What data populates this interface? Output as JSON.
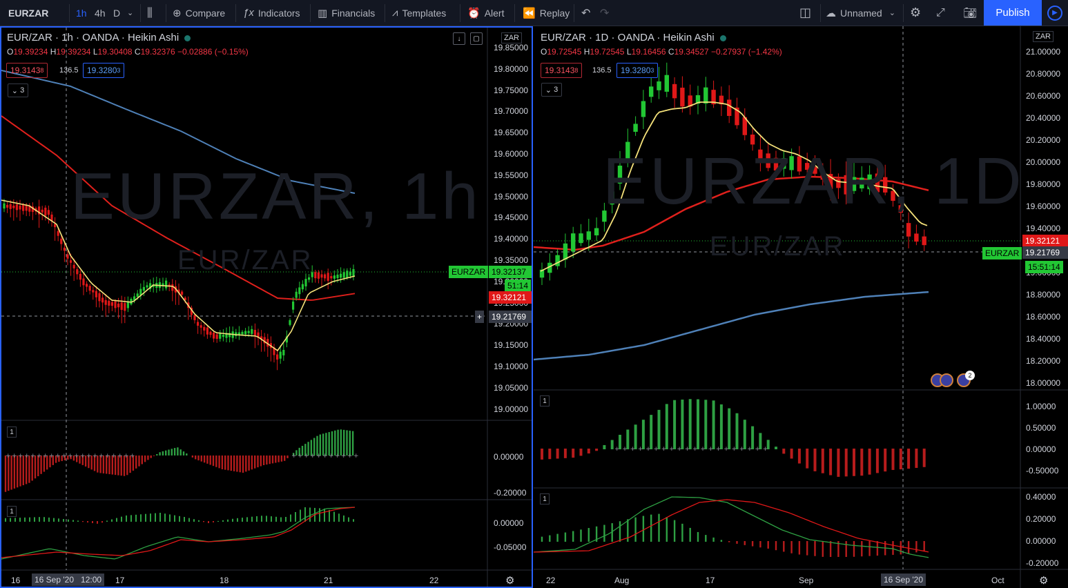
{
  "toolbar": {
    "symbol": "EURZAR",
    "intervals": [
      "1h",
      "4h",
      "D"
    ],
    "compare": "Compare",
    "indicators": "Indicators",
    "financials": "Financials",
    "templates": "Templates",
    "alert": "Alert",
    "replay": "Replay",
    "layout_name": "Unnamed",
    "publish": "Publish"
  },
  "left_chart": {
    "title": "EUR/ZAR · 1h · OANDA · Heikin Ashi",
    "ohlc": {
      "o": "19.39234",
      "h": "19.39234",
      "l": "19.30408",
      "c": "19.32376",
      "chg": "−0.02886 (−0.15%)"
    },
    "ma1": "19.3143",
    "ma1_sub": "8",
    "ma_mid": "136.5",
    "ma2": "19.3280",
    "ma2_sub": "3",
    "collapse": "3",
    "watermark": "EURZAR, 1h",
    "watermark_sub": "EUR/ZAR",
    "currency": "ZAR",
    "price_axis": [
      "19.85000",
      "19.80000",
      "19.75000",
      "19.70000",
      "19.65000",
      "19.60000",
      "19.55000",
      "19.50000",
      "19.45000",
      "19.40000",
      "19.35000",
      "19.30000",
      "19.25000",
      "19.20000",
      "19.15000",
      "19.10000",
      "19.05000",
      "19.00000"
    ],
    "tag_symbol": "EURZAR",
    "tag_price": "19.32137",
    "tag_timer": "51:14",
    "tag_red": "19.32121",
    "tag_cross": "19.21769",
    "osc1_num": "1",
    "osc1_axis": [
      "0.00000",
      "-0.20000"
    ],
    "osc2_num": "1",
    "osc2_axis": [
      "0.00000",
      "-0.05000"
    ],
    "time_axis": [
      "16",
      "17",
      "18",
      "21",
      "22"
    ],
    "time_highlight": "16 Sep '20",
    "time_highlight2": "12:00"
  },
  "right_chart": {
    "title": "EUR/ZAR · 1D · OANDA · Heikin Ashi",
    "ohlc": {
      "o": "19.72545",
      "h": "19.72545",
      "l": "19.16456",
      "c": "19.34527",
      "chg": "−0.27937 (−1.42%)"
    },
    "ma1": "19.3143",
    "ma1_sub": "8",
    "ma_mid": "136.5",
    "ma2": "19.3280",
    "ma2_sub": "3",
    "collapse": "3",
    "watermark": "EURZAR, 1D",
    "watermark_sub": "EUR/ZAR",
    "currency": "ZAR",
    "price_axis": [
      "21.00000",
      "20.80000",
      "20.60000",
      "20.40000",
      "20.20000",
      "20.00000",
      "19.80000",
      "19.60000",
      "19.40000",
      "19.00000",
      "18.80000",
      "18.60000",
      "18.40000",
      "18.20000",
      "18.00000"
    ],
    "tag_red": "19.32121",
    "tag_cross": "19.21769",
    "tag_symbol": "EURZAR",
    "tag_timer": "15:51:14",
    "events_count": "2",
    "osc1_num": "1",
    "osc1_axis": [
      "1.00000",
      "0.50000",
      "0.00000",
      "-0.50000"
    ],
    "osc2_num": "1",
    "osc2_axis": [
      "0.40000",
      "0.20000",
      "0.00000",
      "-0.20000"
    ],
    "time_axis": [
      "22",
      "Aug",
      "17",
      "Sep",
      "Oct"
    ],
    "time_highlight": "16 Sep '20"
  },
  "colors": {
    "up": "#22c734",
    "down": "#e01818",
    "ma_fast": "#f5e27a",
    "ma_mid": "#e0201c",
    "ma_slow": "#4f81b8",
    "accent": "#2962ff"
  }
}
